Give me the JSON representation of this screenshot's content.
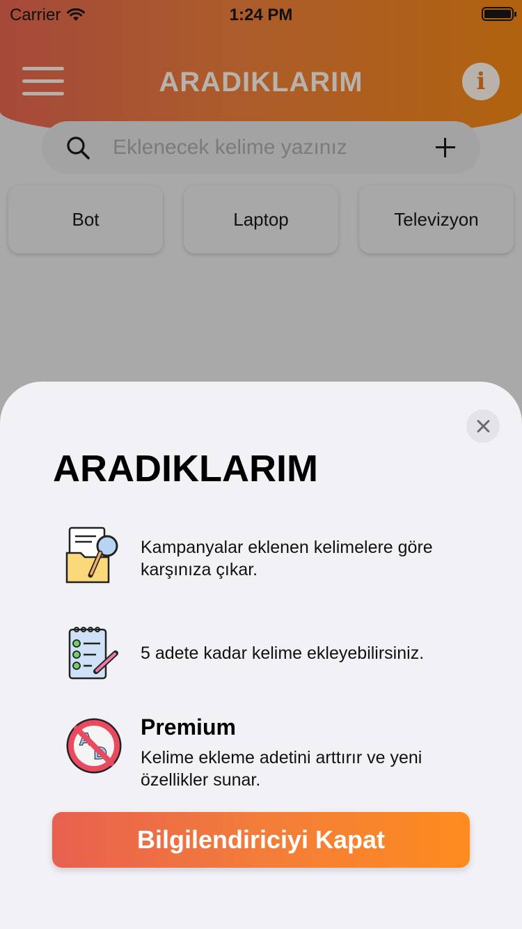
{
  "status_bar": {
    "carrier": "Carrier",
    "time": "1:24 PM"
  },
  "header": {
    "title": "ARADIKLARIM"
  },
  "search": {
    "placeholder": "Eklenecek kelime yazınız",
    "value": ""
  },
  "chips": [
    {
      "label": "Bot"
    },
    {
      "label": "Laptop"
    },
    {
      "label": "Televizyon"
    }
  ],
  "sheet": {
    "title": "ARADIKLARIM",
    "features": [
      {
        "icon": "folder-search-icon",
        "text": "Kampanyalar eklenen kelimelere göre karşınıza çıkar."
      },
      {
        "icon": "checklist-icon",
        "text": "5 adete kadar kelime ekleyebilirsiniz."
      },
      {
        "icon": "no-ads-icon",
        "heading": "Premium",
        "text": "Kelime ekleme adetini arttırır ve yeni özellikler sunar."
      }
    ],
    "close_button_label": "Bilgilendiriciyi Kapat"
  },
  "colors": {
    "accent_start": "#e8604f",
    "accent_end": "#fd8b1e",
    "header_start": "#a5493a",
    "header_end": "#b0620f"
  }
}
